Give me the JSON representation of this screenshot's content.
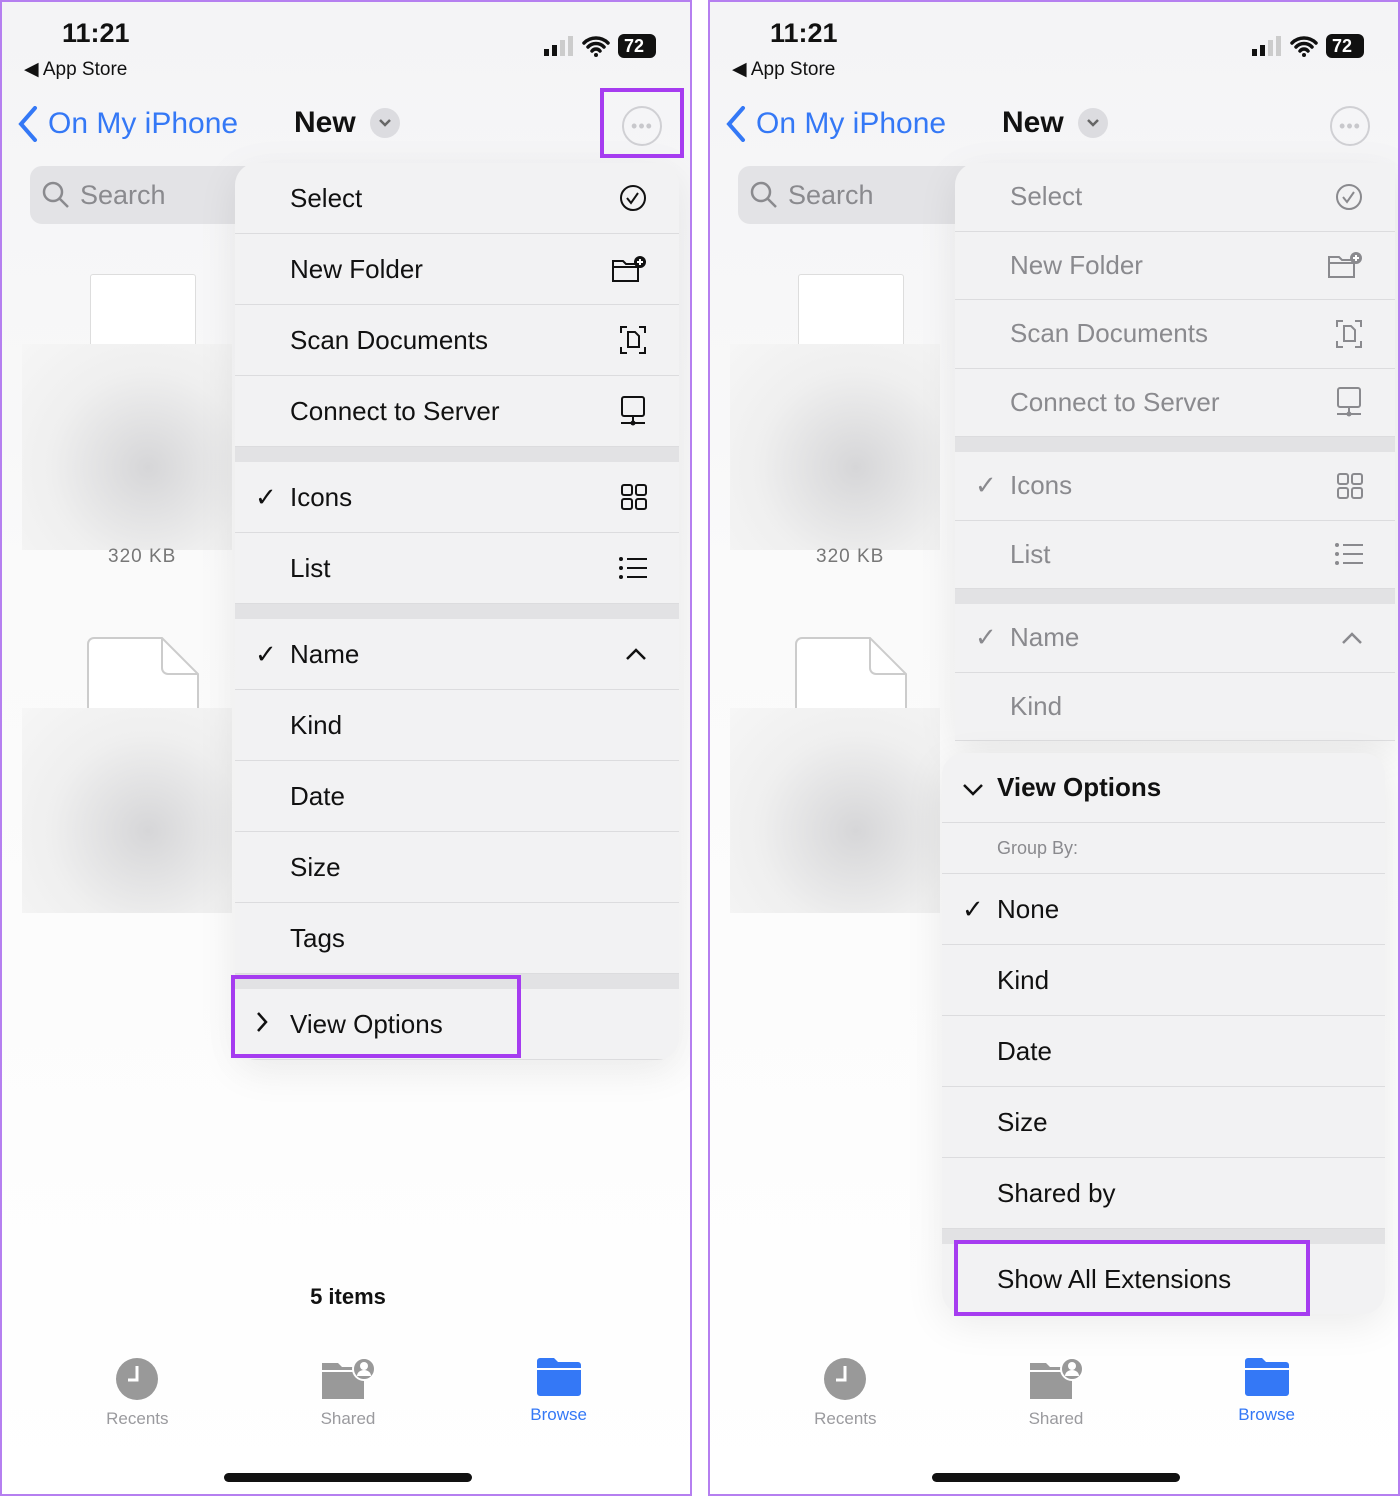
{
  "status": {
    "time": "11:21",
    "back_app": "App Store",
    "battery": "72"
  },
  "nav": {
    "back_label": "On My iPhone",
    "title": "New"
  },
  "search": {
    "placeholder": "Search"
  },
  "files": {
    "size_label": "320 KB",
    "count": "5 items"
  },
  "tabs": [
    {
      "label": "Recents",
      "icon": "clock-icon"
    },
    {
      "label": "Shared",
      "icon": "shared-folder-icon"
    },
    {
      "label": "Browse",
      "icon": "folder-icon",
      "active": true
    }
  ],
  "accent": "#3478f6",
  "highlight_color": "#a63cf0",
  "left_menu": [
    {
      "label": "Select",
      "icon": "checkmark-circle-icon"
    },
    {
      "label": "New Folder",
      "icon": "folder-plus-icon"
    },
    {
      "label": "Scan Documents",
      "icon": "scan-document-icon"
    },
    {
      "label": "Connect to Server",
      "icon": "server-icon"
    },
    {
      "gap": true
    },
    {
      "label": "Icons",
      "icon": "grid-icon",
      "checked": true
    },
    {
      "label": "List",
      "icon": "list-icon"
    },
    {
      "gap": true
    },
    {
      "label": "Name",
      "icon": "chevron-up-icon",
      "checked": true
    },
    {
      "label": "Kind"
    },
    {
      "label": "Date"
    },
    {
      "label": "Size"
    },
    {
      "label": "Tags"
    },
    {
      "gap": true
    },
    {
      "label": "View Options",
      "icon_left": "chevron-right-icon"
    }
  ],
  "right_menu": [
    {
      "label": "Select",
      "icon": "checkmark-circle-icon"
    },
    {
      "label": "New Folder",
      "icon": "folder-plus-icon"
    },
    {
      "label": "Scan Documents",
      "icon": "scan-document-icon"
    },
    {
      "label": "Connect to Server",
      "icon": "server-icon"
    },
    {
      "gap": true
    },
    {
      "label": "Icons",
      "icon": "grid-icon",
      "checked": true
    },
    {
      "label": "List",
      "icon": "list-icon"
    },
    {
      "gap": true
    },
    {
      "label": "Name",
      "icon": "chevron-up-icon",
      "checked": true
    },
    {
      "label": "Kind"
    }
  ],
  "view_options": {
    "title": "View Options",
    "group_by_label": "Group By:",
    "items": [
      {
        "label": "None",
        "checked": true
      },
      {
        "label": "Kind"
      },
      {
        "label": "Date"
      },
      {
        "label": "Size"
      },
      {
        "label": "Shared by"
      }
    ],
    "extensions_label": "Show All Extensions"
  }
}
